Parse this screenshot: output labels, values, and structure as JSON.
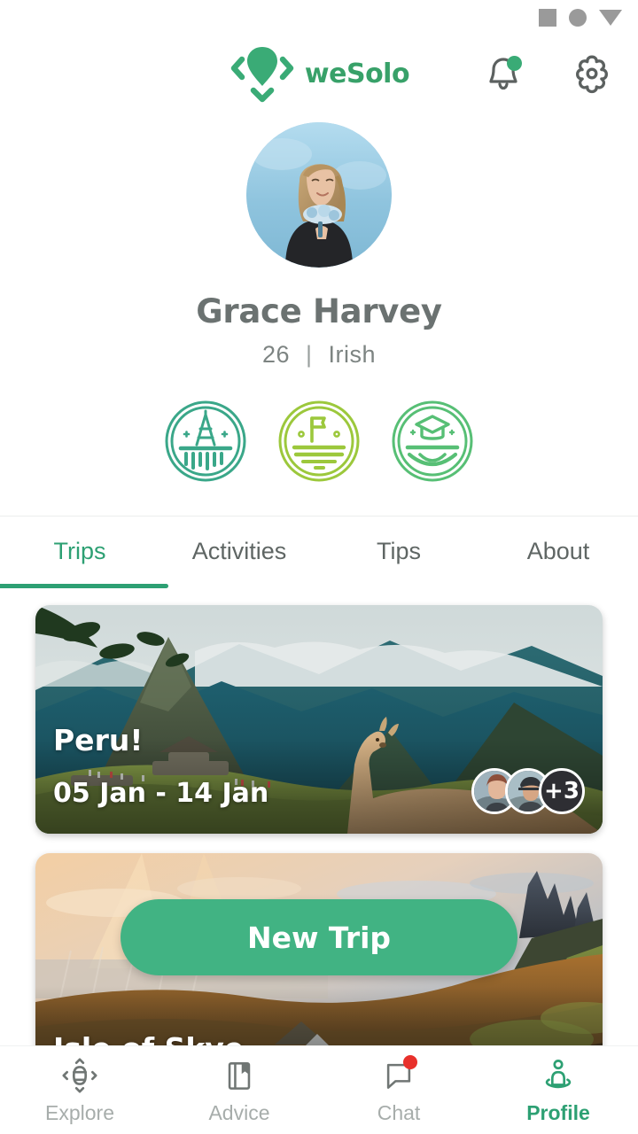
{
  "statusbar": {
    "icons": [
      "square-icon",
      "circle-icon",
      "triangle-down-icon"
    ]
  },
  "header": {
    "brand_name": "weSolo",
    "logo_icon": "map-pin-logo-icon",
    "notifications_icon": "bell-icon",
    "notifications_badge": true,
    "settings_icon": "gear-icon"
  },
  "profile": {
    "avatar_alt": "profile-photo",
    "name": "Grace Harvey",
    "age": "26",
    "separator": "|",
    "nationality": "Irish",
    "badges": [
      {
        "name": "tower-badge",
        "icon": "eiffel-tower-icon",
        "color": "#3aa789"
      },
      {
        "name": "flag-badge",
        "icon": "flag-icon",
        "color": "#9cc83c"
      },
      {
        "name": "graduation-badge",
        "icon": "graduation-cap-icon",
        "color": "#57bf75"
      }
    ]
  },
  "tabs": {
    "active_index": 0,
    "items": [
      {
        "label": "Trips"
      },
      {
        "label": "Activities"
      },
      {
        "label": "Tips"
      },
      {
        "label": "About"
      }
    ]
  },
  "trips": [
    {
      "title": "Peru!",
      "dates": "05 Jan - 14 Jan",
      "image_alt": "machu-picchu-llama-photo",
      "participants_overflow": "+3",
      "participant_count": 3
    },
    {
      "title": "Isle of Skye",
      "dates": "",
      "image_alt": "isle-of-skye-sunset-photo"
    }
  ],
  "fab": {
    "label": "New Trip"
  },
  "bottomnav": {
    "active_index": 3,
    "items": [
      {
        "label": "Explore",
        "icon": "explore-compass-icon",
        "badge": false
      },
      {
        "label": "Advice",
        "icon": "book-bookmark-icon",
        "badge": false
      },
      {
        "label": "Chat",
        "icon": "chat-bubble-icon",
        "badge": true
      },
      {
        "label": "Profile",
        "icon": "person-pin-icon",
        "badge": false
      }
    ]
  },
  "colors": {
    "brand_green": "#38a169",
    "accent_green": "#2da073",
    "fab_green": "#41b383",
    "notification_green": "#3aab76",
    "chat_red": "#e8302b",
    "text_dark": "#6b7271",
    "text_muted": "#a7adab"
  }
}
